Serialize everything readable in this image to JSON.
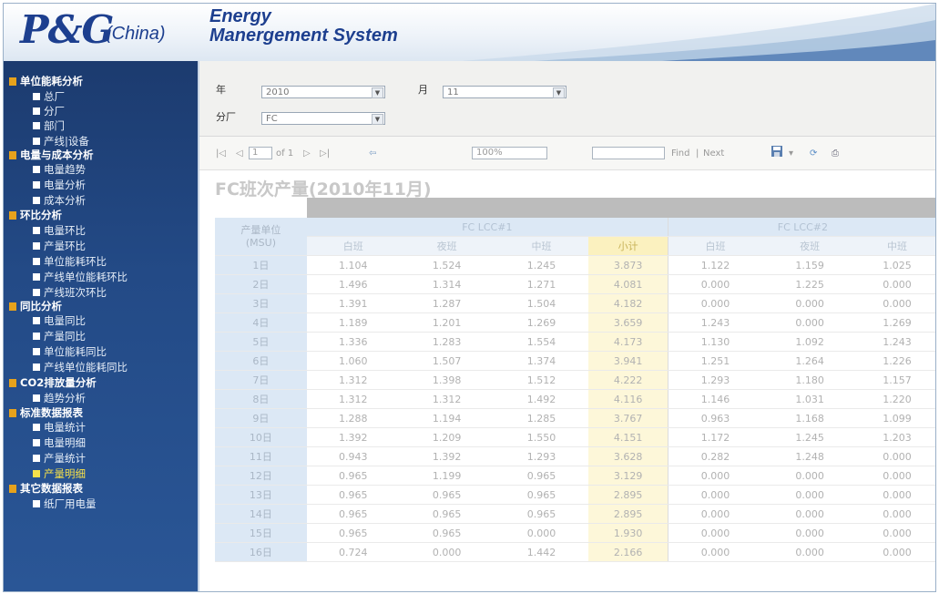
{
  "header": {
    "logo_main": "P&G",
    "logo_sub": "(China)",
    "title_line1": "Energy",
    "title_line2": "Manergement System"
  },
  "sidebar": [
    {
      "kind": "cat",
      "label": "单位能耗分析"
    },
    {
      "kind": "sub",
      "label": "总厂"
    },
    {
      "kind": "sub",
      "label": "分厂"
    },
    {
      "kind": "sub",
      "label": "部门"
    },
    {
      "kind": "sub",
      "label": "产线|设备"
    },
    {
      "kind": "cat",
      "label": "电量与成本分析"
    },
    {
      "kind": "sub",
      "label": "电量趋势"
    },
    {
      "kind": "sub",
      "label": "电量分析"
    },
    {
      "kind": "sub",
      "label": "成本分析"
    },
    {
      "kind": "cat",
      "label": "环比分析"
    },
    {
      "kind": "sub",
      "label": "电量环比"
    },
    {
      "kind": "sub",
      "label": "产量环比"
    },
    {
      "kind": "sub",
      "label": "单位能耗环比"
    },
    {
      "kind": "sub",
      "label": "产线单位能耗环比"
    },
    {
      "kind": "sub",
      "label": "产线班次环比"
    },
    {
      "kind": "cat",
      "label": "同比分析"
    },
    {
      "kind": "sub",
      "label": "电量同比"
    },
    {
      "kind": "sub",
      "label": "产量同比"
    },
    {
      "kind": "sub",
      "label": "单位能耗同比"
    },
    {
      "kind": "sub",
      "label": "产线单位能耗同比"
    },
    {
      "kind": "cat",
      "label": "CO2排放量分析"
    },
    {
      "kind": "sub",
      "label": "趋势分析"
    },
    {
      "kind": "cat",
      "label": "标准数据报表"
    },
    {
      "kind": "sub",
      "label": "电量统计"
    },
    {
      "kind": "sub",
      "label": "电量明细"
    },
    {
      "kind": "sub",
      "label": "产量统计"
    },
    {
      "kind": "sub",
      "label": "产量明细",
      "active": true
    },
    {
      "kind": "cat",
      "label": "其它数据报表"
    },
    {
      "kind": "sub",
      "label": "纸厂用电量"
    }
  ],
  "params": {
    "year_label": "年",
    "year_value": "2010",
    "month_label": "月",
    "month_value": "11",
    "plant_label": "分厂",
    "plant_value": "FC"
  },
  "toolbar": {
    "first": "|◁",
    "prev": "◁",
    "page": "1",
    "of_pages": "of 1",
    "next": "▷",
    "last": "▷|",
    "back": "⇦",
    "zoom": "100%",
    "find_label": "Find",
    "find_sep": "|",
    "next_label": "Next",
    "export": "▾",
    "refresh": "⟳",
    "print": "⎙"
  },
  "report": {
    "title": "FC班次产量(2010年11月)",
    "unit_header_line1": "产量单位",
    "unit_header_line2": "(MSU)",
    "groups": [
      "FC LCC#1",
      "FC LCC#2"
    ],
    "shifts1": [
      "白班",
      "夜班",
      "中班",
      "小计"
    ],
    "shifts2": [
      "白班",
      "夜班",
      "中班"
    ],
    "rows": [
      {
        "day": "1日",
        "v": [
          "1.104",
          "1.524",
          "1.245",
          "3.873",
          "1.122",
          "1.159",
          "1.025"
        ]
      },
      {
        "day": "2日",
        "v": [
          "1.496",
          "1.314",
          "1.271",
          "4.081",
          "0.000",
          "1.225",
          "0.000"
        ]
      },
      {
        "day": "3日",
        "v": [
          "1.391",
          "1.287",
          "1.504",
          "4.182",
          "0.000",
          "0.000",
          "0.000"
        ]
      },
      {
        "day": "4日",
        "v": [
          "1.189",
          "1.201",
          "1.269",
          "3.659",
          "1.243",
          "0.000",
          "1.269"
        ]
      },
      {
        "day": "5日",
        "v": [
          "1.336",
          "1.283",
          "1.554",
          "4.173",
          "1.130",
          "1.092",
          "1.243"
        ]
      },
      {
        "day": "6日",
        "v": [
          "1.060",
          "1.507",
          "1.374",
          "3.941",
          "1.251",
          "1.264",
          "1.226"
        ]
      },
      {
        "day": "7日",
        "v": [
          "1.312",
          "1.398",
          "1.512",
          "4.222",
          "1.293",
          "1.180",
          "1.157"
        ]
      },
      {
        "day": "8日",
        "v": [
          "1.312",
          "1.312",
          "1.492",
          "4.116",
          "1.146",
          "1.031",
          "1.220"
        ]
      },
      {
        "day": "9日",
        "v": [
          "1.288",
          "1.194",
          "1.285",
          "3.767",
          "0.963",
          "1.168",
          "1.099"
        ]
      },
      {
        "day": "10日",
        "v": [
          "1.392",
          "1.209",
          "1.550",
          "4.151",
          "1.172",
          "1.245",
          "1.203"
        ]
      },
      {
        "day": "11日",
        "v": [
          "0.943",
          "1.392",
          "1.293",
          "3.628",
          "0.282",
          "1.248",
          "0.000"
        ]
      },
      {
        "day": "12日",
        "v": [
          "0.965",
          "1.199",
          "0.965",
          "3.129",
          "0.000",
          "0.000",
          "0.000"
        ]
      },
      {
        "day": "13日",
        "v": [
          "0.965",
          "0.965",
          "0.965",
          "2.895",
          "0.000",
          "0.000",
          "0.000"
        ]
      },
      {
        "day": "14日",
        "v": [
          "0.965",
          "0.965",
          "0.965",
          "2.895",
          "0.000",
          "0.000",
          "0.000"
        ]
      },
      {
        "day": "15日",
        "v": [
          "0.965",
          "0.965",
          "0.000",
          "1.930",
          "0.000",
          "0.000",
          "0.000"
        ]
      },
      {
        "day": "16日",
        "v": [
          "0.724",
          "0.000",
          "1.442",
          "2.166",
          "0.000",
          "0.000",
          "0.000"
        ]
      }
    ]
  },
  "colors": {
    "sidebar": "#234a86",
    "accent_active": "#f5e04a",
    "category_marker": "#e6a21c",
    "brand": "#1d3f8f"
  }
}
